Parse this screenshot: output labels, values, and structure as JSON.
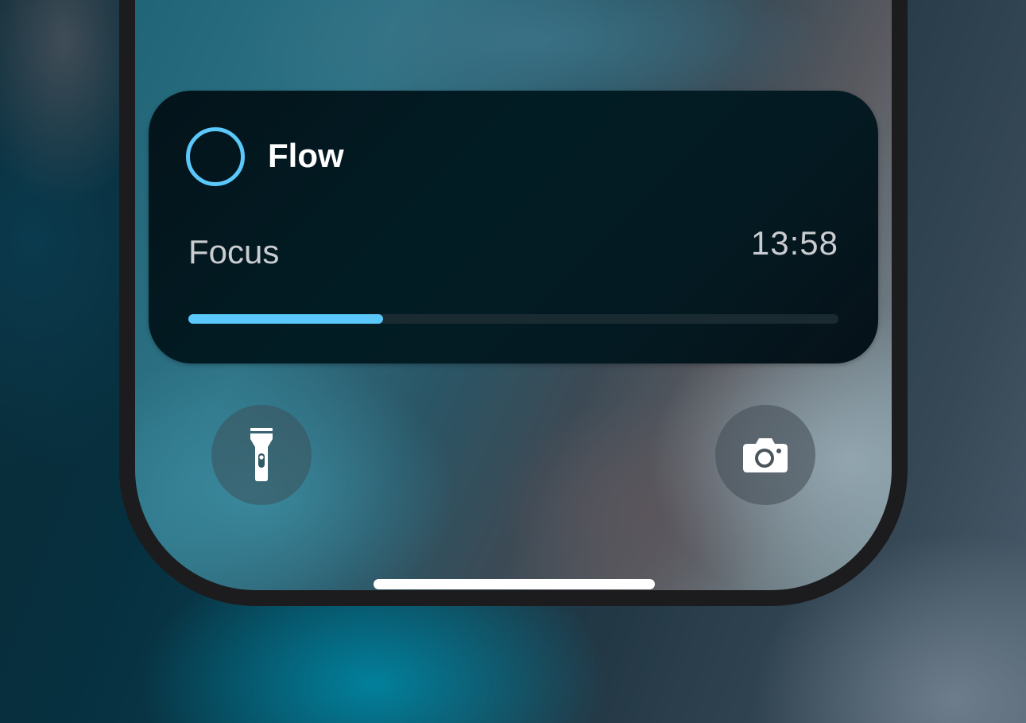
{
  "widget": {
    "title": "Flow",
    "mode": "Focus",
    "time_remaining": "13:58",
    "progress_fraction": 0.3,
    "accent_color": "#5ac8fa"
  },
  "quick_actions": {
    "left_icon": "flashlight-icon",
    "right_icon": "camera-icon"
  },
  "colors": {
    "widget_bg": "#031a22",
    "progress_track": "#1a2a31",
    "progress_fill": "#5ac8fa"
  }
}
